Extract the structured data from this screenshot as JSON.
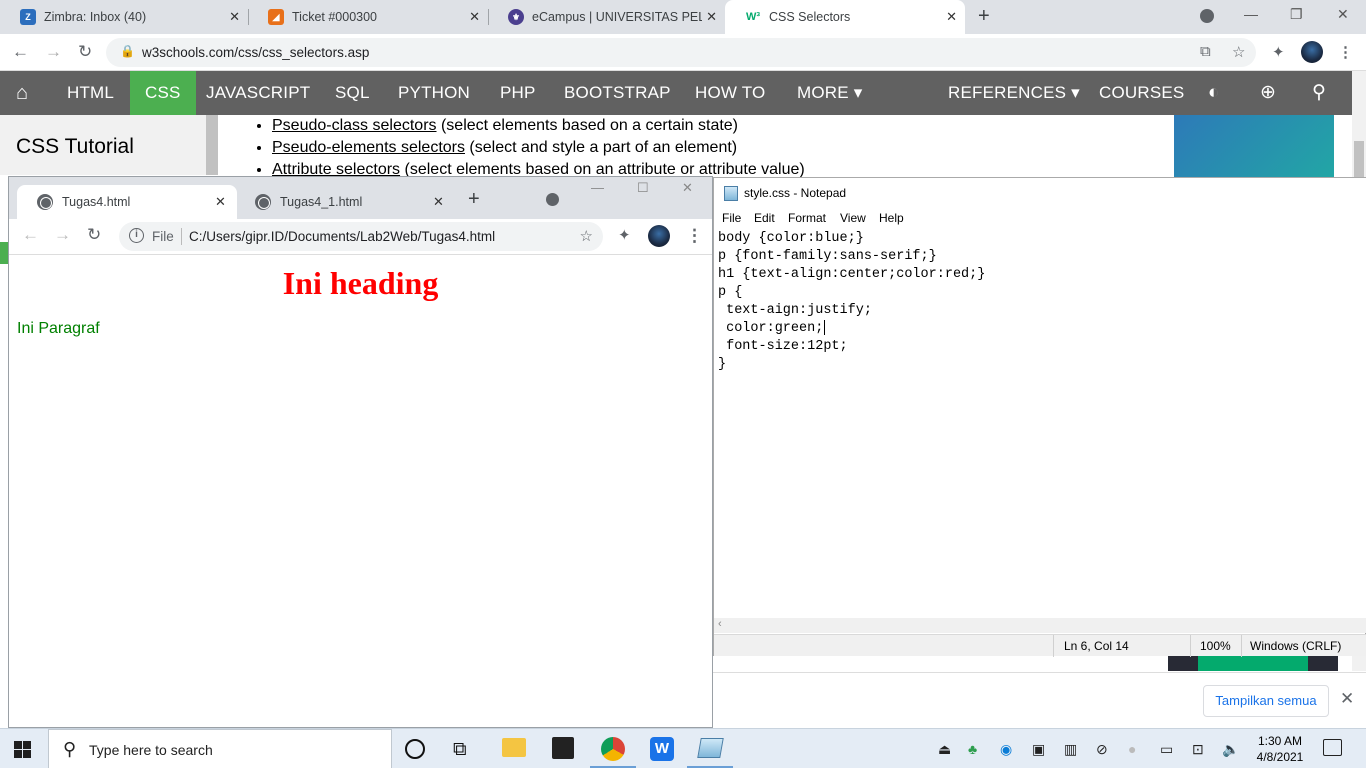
{
  "back_browser": {
    "tabs": [
      {
        "label": "Zimbra: Inbox (40)",
        "fav_color": "#2c6ebd",
        "fav_text": "Z"
      },
      {
        "label": "Ticket #000300",
        "fav_color": "#e8701a",
        "fav_text": ""
      },
      {
        "label": "eCampus | UNIVERSITAS PELITA B",
        "fav_color": "#4b3f8f",
        "fav_text": ""
      },
      {
        "label": "CSS Selectors",
        "fav_color": "#ffffff",
        "fav_text": "W3"
      }
    ],
    "url": "w3schools.com/css/css_selectors.asp"
  },
  "w3": {
    "nav": [
      "HTML",
      "CSS",
      "JAVASCRIPT",
      "SQL",
      "PYTHON",
      "PHP",
      "BOOTSTRAP",
      "HOW TO",
      "MORE ▾"
    ],
    "nav_right": [
      "REFERENCES ▾",
      "COURSES"
    ],
    "sidebar_title": "CSS Tutorial",
    "list": [
      {
        "link": "Pseudo-class selectors",
        "rest": " (select elements based on a certain state)"
      },
      {
        "link": "Pseudo-elements selectors",
        "rest": " (select and style a part of an element)"
      },
      {
        "link": "Attribute selectors",
        "rest": " (select elements based on an attribute or attribute value)"
      }
    ],
    "accent_color": "#4caf50"
  },
  "download_bar": {
    "button": "Tampilkan semua"
  },
  "chrome2": {
    "tabs": [
      "Tugas4.html",
      "Tugas4_1.html"
    ],
    "file_label": "File",
    "path": "C:/Users/gipr.ID/Documents/Lab2Web/Tugas4.html",
    "heading": "Ini heading",
    "paragraph": "Ini Paragraf"
  },
  "notepad": {
    "title": "style.css - Notepad",
    "menu": [
      "File",
      "Edit",
      "Format",
      "View",
      "Help"
    ],
    "lines": [
      "body {color:blue;}",
      "p {font-family:sans-serif;}",
      "h1 {text-align:center;color:red;}",
      "p {",
      " text-aign:justify;",
      " color:green;",
      " font-size:12pt;",
      "}"
    ],
    "status": {
      "position": "Ln 6, Col 14",
      "zoom": "100%",
      "eol": "Windows (CRLF)"
    }
  },
  "taskbar": {
    "search_placeholder": "Type here to search",
    "time": "1:30 AM",
    "date": "4/8/2021"
  }
}
